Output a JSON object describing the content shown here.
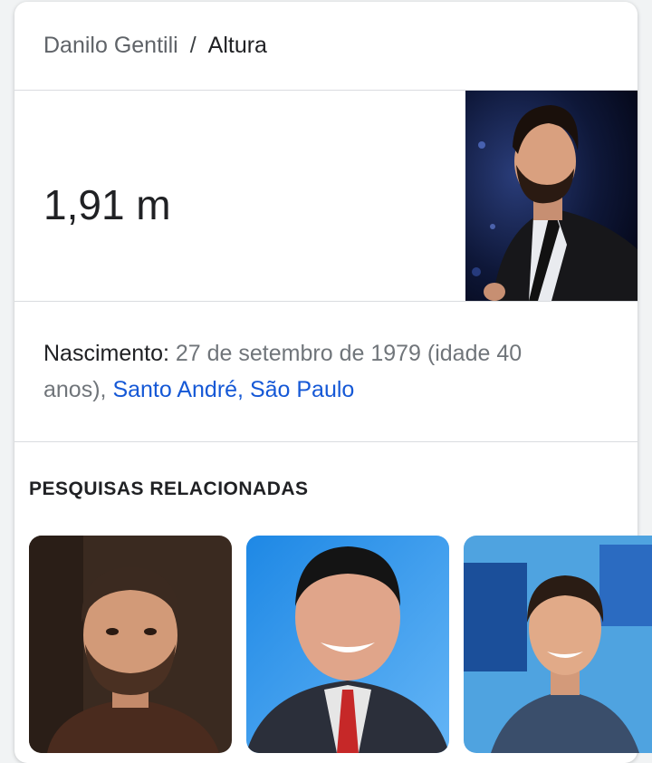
{
  "breadcrumb": {
    "entity": "Danilo Gentili",
    "separator": "/",
    "attribute": "Altura"
  },
  "answer": {
    "value": "1,91 m"
  },
  "birth": {
    "label": "Nascimento:",
    "text": " 27 de setembro de 1979 (idade 40 anos), ",
    "place": "Santo André, São Paulo"
  },
  "related": {
    "title": "PESQUISAS RELACIONADAS"
  },
  "colors": {
    "link": "#1558d6",
    "secondary_text": "#70757a",
    "divider": "#dadce0"
  }
}
